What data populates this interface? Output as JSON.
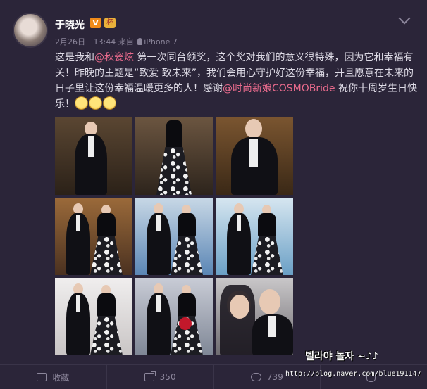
{
  "post": {
    "username": "于晓光",
    "vip_badge": "V",
    "medal": "杯",
    "date": "2月26日",
    "time": "13:44",
    "source_prefix": "来自",
    "source_device": "iPhone 7",
    "text_segments": [
      {
        "type": "text",
        "value": "这是我和"
      },
      {
        "type": "link",
        "value": "@秋瓷炫"
      },
      {
        "type": "text",
        "value": " 第一次同台领奖，这个奖对我们的意义很特殊，因为它和幸福有关！昨晚的主题是“致爱 致未来”，我们会用心守护好这份幸福，并且愿意在未来的日子里让这份幸福温暖更多的人！感谢"
      },
      {
        "type": "link",
        "value": "@时尚新娘COSMOBride"
      },
      {
        "type": "text",
        "value": " 祝你十周岁生日快乐！"
      }
    ],
    "emoji_count": 3,
    "emoji_name": "emoji-face-icon"
  },
  "photos": [
    {
      "scene": "man-hallway",
      "bg": "#5a4632",
      "bg2": "#2b2118"
    },
    {
      "scene": "woman-hallway",
      "bg": "#6b5540",
      "bg2": "#2d241c"
    },
    {
      "scene": "man-closeup",
      "bg": "#7a5530",
      "bg2": "#3a2816"
    },
    {
      "scene": "couple-wood",
      "bg": "#9b6a3a",
      "bg2": "#4a3120"
    },
    {
      "scene": "couple-blue",
      "bg": "#c8d8e6",
      "bg2": "#5b86b5"
    },
    {
      "scene": "couple-blue-2",
      "bg": "#d6e6f0",
      "bg2": "#6ba0c6"
    },
    {
      "scene": "couple-white",
      "bg": "#f0eeee",
      "bg2": "#c9c5c5"
    },
    {
      "scene": "couple-flowers",
      "bg": "#c9ccd6",
      "bg2": "#7f8796"
    },
    {
      "scene": "selfie",
      "bg": "#c9c7c9",
      "bg2": "#6e6b70"
    }
  ],
  "footer": {
    "favorite_label": "收藏",
    "share_count": "350",
    "comment_count": "739",
    "like_count": ""
  },
  "watermark": {
    "text": "벨라야 놀자 ~♪♪",
    "url": "http://blog.naver.com/blue191147"
  },
  "colors": {
    "background": "#2b2539",
    "link": "#e86a8c",
    "meta": "#8c869b"
  }
}
